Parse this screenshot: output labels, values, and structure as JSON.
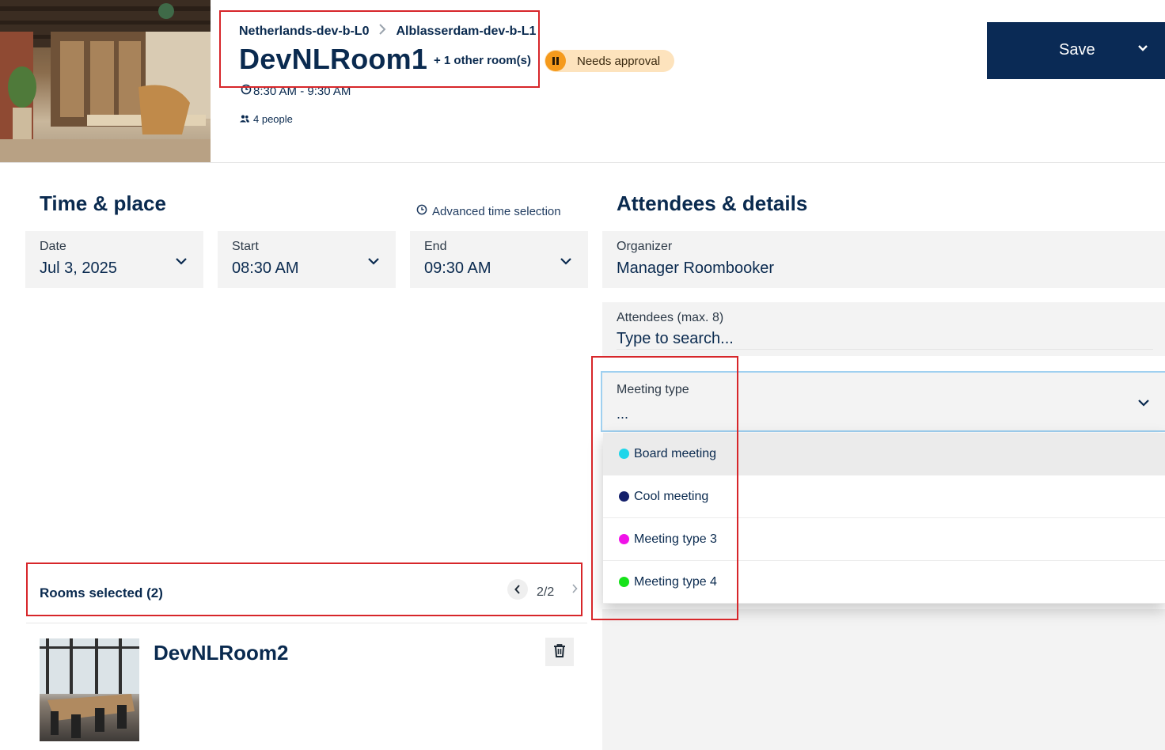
{
  "header": {
    "breadcrumb": [
      "Netherlands-dev-b-L0",
      "Alblasserdam-dev-b-L1"
    ],
    "room_title": "DevNLRoom1",
    "other_rooms": "+ 1 other room(s)",
    "status": "Needs approval",
    "time_range": "8:30 AM - 9:30 AM",
    "people": "4 people",
    "save_label": "Save"
  },
  "time_place": {
    "title": "Time & place",
    "advanced_link": "Advanced time selection",
    "date": {
      "label": "Date",
      "value": "Jul 3, 2025"
    },
    "start": {
      "label": "Start",
      "value": "08:30 AM"
    },
    "end": {
      "label": "End",
      "value": "09:30 AM"
    },
    "rooms_selected": "Rooms selected (2)",
    "pager": "2/2",
    "room_card": {
      "title": "DevNLRoom2"
    }
  },
  "attendees_details": {
    "title": "Attendees & details",
    "organizer": {
      "label": "Organizer",
      "value": "Manager Roombooker"
    },
    "attendees": {
      "label": "Attendees (max. 8)",
      "placeholder": "Type to search..."
    },
    "meeting_type": {
      "label": "Meeting type",
      "value": "...",
      "options": [
        {
          "name": "Board meeting",
          "color": "#1ed6ea"
        },
        {
          "name": "Cool meeting",
          "color": "#14206b"
        },
        {
          "name": "Meeting type 3",
          "color": "#f012e8"
        },
        {
          "name": "Meeting type 4",
          "color": "#16e21a"
        }
      ]
    }
  },
  "colors": {
    "primary": "#0a2a55",
    "status_badge_bg": "#fde3bd",
    "status_icon": "#f59a1c",
    "annotation": "#d7262a"
  }
}
